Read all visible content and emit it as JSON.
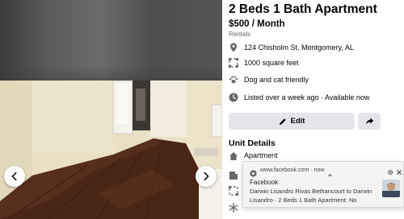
{
  "listing": {
    "title": "2 Beds 1 Bath Apartment",
    "price": "$500 / Month",
    "category": "Rentals",
    "address": "124 Chisholm St, Montgomery, AL",
    "size": "1000 square feet",
    "pets": "Dog and cat friendly",
    "listed": "Listed over a week ago · Available now"
  },
  "actions": {
    "edit_label": "Edit"
  },
  "unit_details": {
    "title": "Unit Details",
    "items": [
      {
        "label": "Apartment",
        "icon": "building-icon"
      }
    ]
  },
  "notification": {
    "source": "www.facebook.com · now",
    "app": "Facebook",
    "line1": "Darwin Lisandro Rivas Bethancourt to Darwin",
    "line2": "Lisandro · 2 Beds 1 Bath Apartment: No"
  },
  "colors": {
    "icon_gray": "#65676b",
    "button_bg": "#e4e6eb",
    "text": "#050505",
    "floor": "#4a2616",
    "wall": "#eae1c7"
  }
}
